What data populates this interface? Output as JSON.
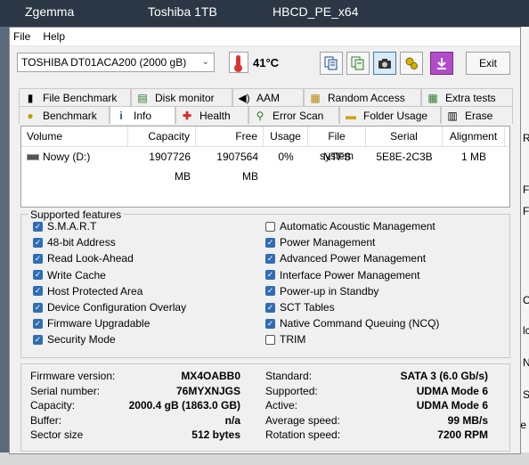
{
  "desktop": {
    "labels": [
      "Zgemma",
      "Toshiba 1TB",
      "HBCD_PE_x64"
    ],
    "right_fragments": [
      "R",
      "F",
      "F",
      "C",
      "lc",
      "N",
      "S",
      "te"
    ]
  },
  "menu": {
    "file": "File",
    "help": "Help"
  },
  "toolbar": {
    "drive": "TOSHIBA DT01ACA200 (2000 gB)",
    "temperature": "41°C",
    "exit_label": "Exit",
    "icons": [
      "copy-text-icon",
      "copy-info-icon",
      "camera-icon",
      "options-icon",
      "download-icon"
    ]
  },
  "tabs_row1": [
    {
      "label": "File Benchmark",
      "icon": "file-benchmark-icon"
    },
    {
      "label": "Disk monitor",
      "icon": "disk-monitor-icon"
    },
    {
      "label": "AAM",
      "icon": "speaker-icon"
    },
    {
      "label": "Random Access",
      "icon": "random-access-icon"
    },
    {
      "label": "Extra tests",
      "icon": "extra-tests-icon"
    }
  ],
  "tabs_row2": [
    {
      "label": "Benchmark",
      "icon": "benchmark-icon"
    },
    {
      "label": "Info",
      "icon": "info-icon"
    },
    {
      "label": "Health",
      "icon": "health-icon"
    },
    {
      "label": "Error Scan",
      "icon": "error-scan-icon"
    },
    {
      "label": "Folder Usage",
      "icon": "folder-usage-icon"
    },
    {
      "label": "Erase",
      "icon": "erase-icon"
    }
  ],
  "volumes": {
    "headers": [
      "Volume",
      "Capacity",
      "Free",
      "Usage",
      "File system",
      "Serial",
      "Alignment"
    ],
    "rows": [
      [
        "Nowy (D:)",
        "1907726 MB",
        "1907564 MB",
        "0%",
        "NTFS",
        "5E8E-2C3B",
        "1 MB"
      ]
    ]
  },
  "features": {
    "legend": "Supported features",
    "left": [
      {
        "label": "S.M.A.R.T",
        "checked": true
      },
      {
        "label": "48-bit Address",
        "checked": true
      },
      {
        "label": "Read Look-Ahead",
        "checked": true
      },
      {
        "label": "Write Cache",
        "checked": true
      },
      {
        "label": "Host Protected Area",
        "checked": true
      },
      {
        "label": "Device Configuration Overlay",
        "checked": true
      },
      {
        "label": "Firmware Upgradable",
        "checked": true
      },
      {
        "label": "Security Mode",
        "checked": true
      }
    ],
    "right": [
      {
        "label": "Automatic Acoustic Management",
        "checked": false
      },
      {
        "label": "Power Management",
        "checked": true
      },
      {
        "label": "Advanced Power Management",
        "checked": true
      },
      {
        "label": "Interface Power Management",
        "checked": true
      },
      {
        "label": "Power-up in Standby",
        "checked": true
      },
      {
        "label": "SCT Tables",
        "checked": true
      },
      {
        "label": "Native Command Queuing (NCQ)",
        "checked": true
      },
      {
        "label": "TRIM",
        "checked": false
      }
    ]
  },
  "info": {
    "left": [
      {
        "label": "Firmware version:",
        "value": "MX4OABB0"
      },
      {
        "label": "Serial number:",
        "value": "76MYXNJGS"
      },
      {
        "label": "Capacity:",
        "value": "2000.4 gB (1863.0 GB)"
      },
      {
        "label": "Buffer:",
        "value": "n/a"
      },
      {
        "label": "Sector size",
        "value": "512 bytes"
      }
    ],
    "right": [
      {
        "label": "Standard:",
        "value": "SATA 3 (6.0 Gb/s)"
      },
      {
        "label": "Supported:",
        "value": "UDMA Mode 6"
      },
      {
        "label": "Active:",
        "value": "UDMA Mode 6"
      },
      {
        "label": "Average speed:",
        "value": "99 MB/s"
      },
      {
        "label": "Rotation speed:",
        "value": "7200 RPM"
      }
    ]
  },
  "colors": {
    "checkbox_on": "#2f6db5",
    "selected_tab": "#ffffff"
  }
}
